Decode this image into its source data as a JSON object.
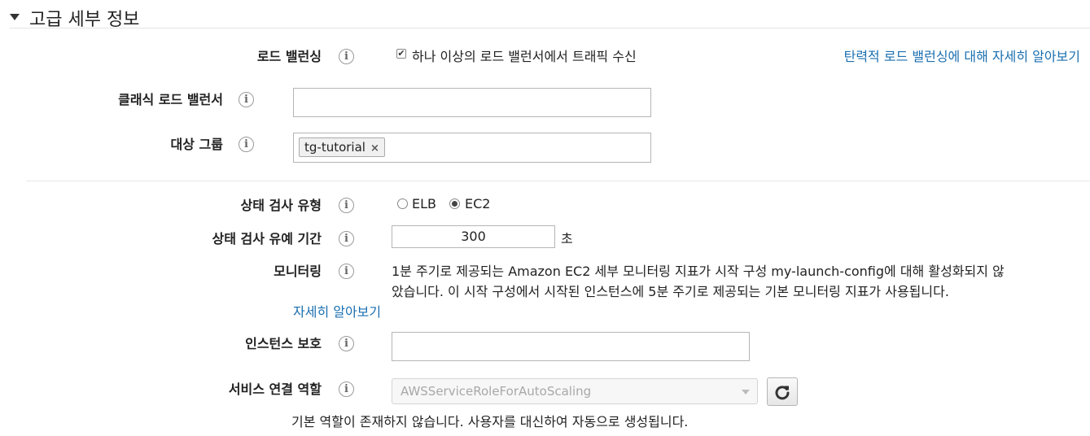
{
  "section": {
    "title": "고급 세부 정보"
  },
  "load_balancing": {
    "label": "로드 밸런싱",
    "checkbox_label": "하나 이상의 로드 밸런서에서 트래픽 수신",
    "checked": true,
    "learn_more": "탄력적 로드 밸런싱에 대해 자세히 알아보기"
  },
  "classic_lb": {
    "label": "클래식 로드 밸런서",
    "value": ""
  },
  "target_groups": {
    "label": "대상 그룹",
    "tags": [
      "tg-tutorial"
    ]
  },
  "health_check_type": {
    "label": "상태 검사 유형",
    "options": [
      "ELB",
      "EC2"
    ],
    "selected": "EC2"
  },
  "health_check_grace": {
    "label": "상태 검사 유예 기간",
    "value": "300",
    "unit": "초"
  },
  "monitoring": {
    "label": "모니터링",
    "line1": "1분 주기로 제공되는 Amazon EC2 세부 모니터링 지표가 시작 구성 my-launch-config에 대해 활성화되지 않",
    "line2": "았습니다. 이 시작 구성에서 시작된 인스턴스에 5분 주기로 제공되는 기본 모니터링 지표가 사용됩니다.",
    "learn_more": "자세히 알아보기"
  },
  "instance_protection": {
    "label": "인스턴스 보호",
    "value": ""
  },
  "service_role": {
    "label": "서비스 연결 역할",
    "selected": "AWSServiceRoleForAutoScaling",
    "note": "기본 역할이 존재하지 않습니다. 사용자를 대신하여 자동으로 생성됩니다."
  },
  "icons": {
    "info": "i",
    "tag_remove": "×",
    "check": "✔"
  }
}
